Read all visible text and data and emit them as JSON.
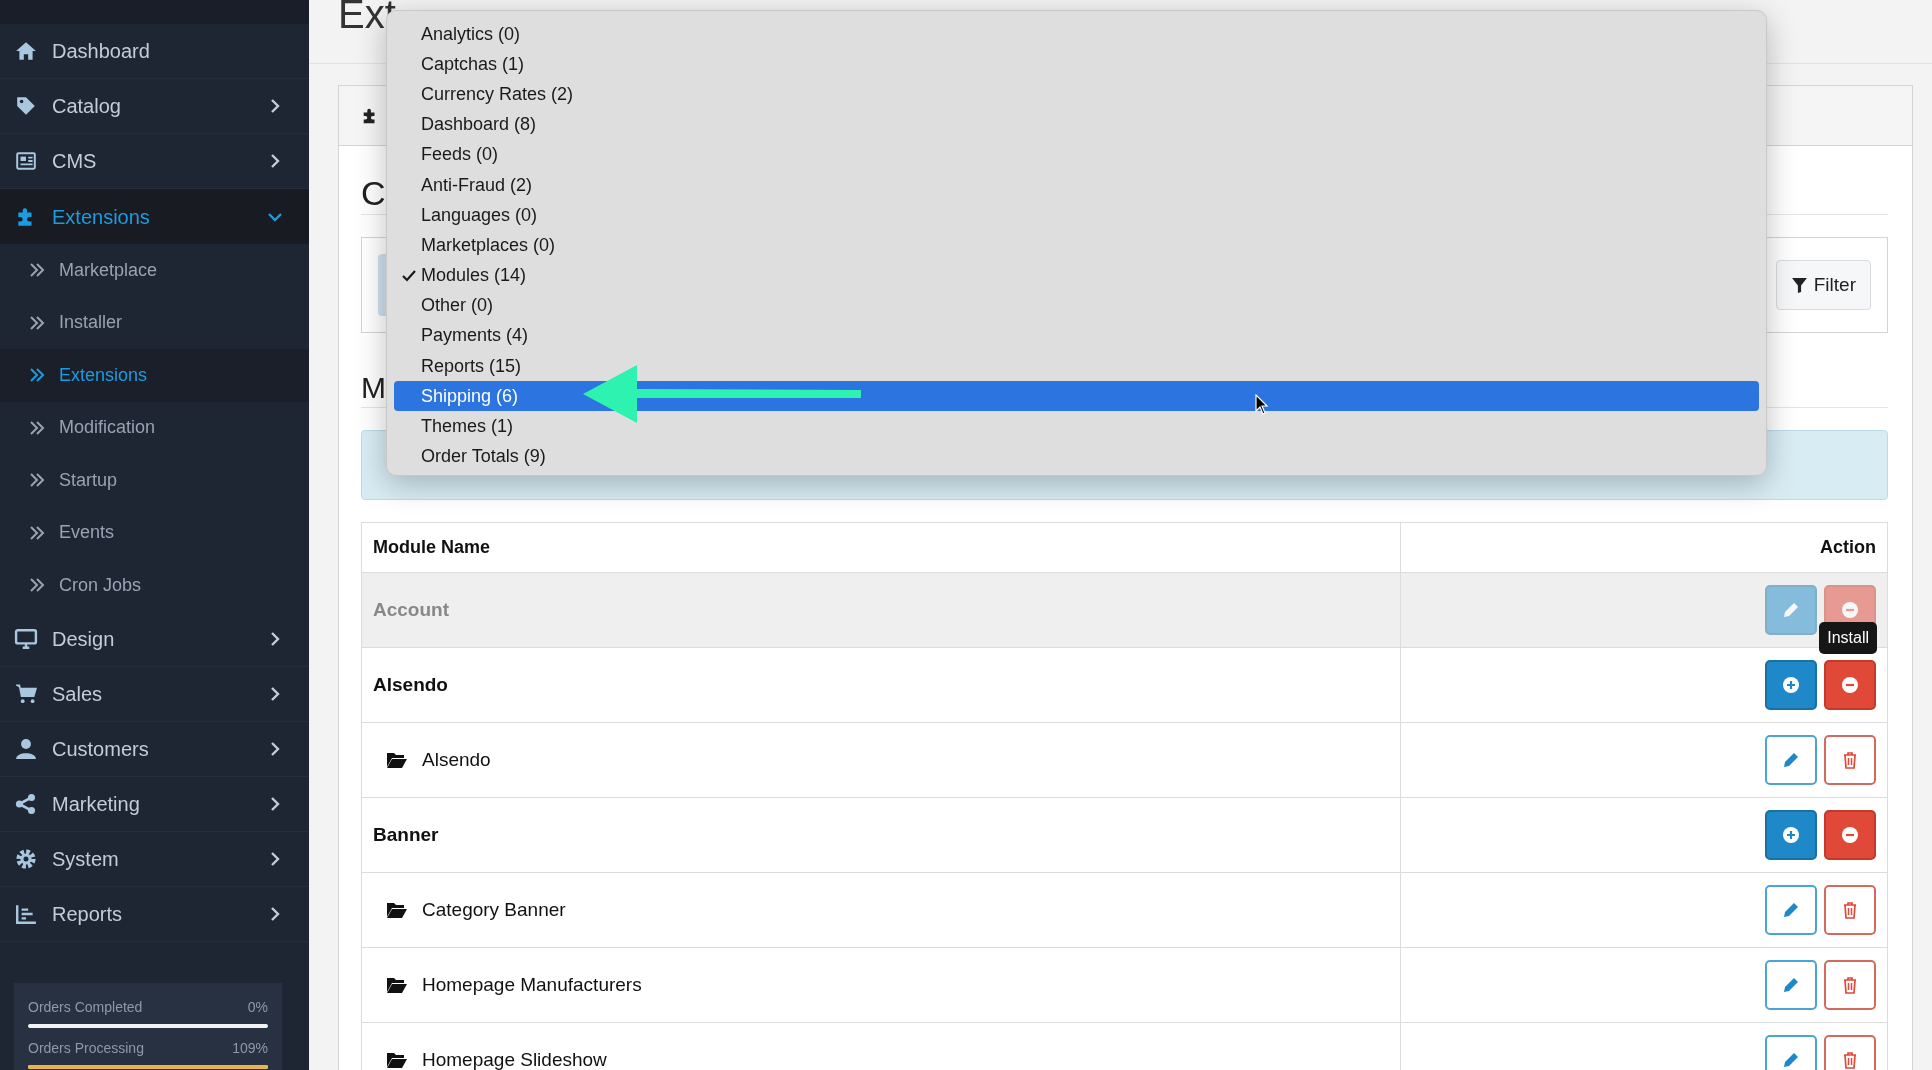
{
  "sidebar": {
    "items": [
      {
        "label": "Dashboard",
        "kind": "home",
        "expandable": false,
        "expanded": false
      },
      {
        "label": "Catalog",
        "kind": "tag",
        "expandable": true,
        "expanded": false
      },
      {
        "label": "CMS",
        "kind": "newspaper",
        "expandable": true,
        "expanded": false
      },
      {
        "label": "Extensions",
        "kind": "puzzle",
        "expandable": true,
        "expanded": true,
        "children": [
          {
            "label": "Marketplace",
            "selected": false
          },
          {
            "label": "Installer",
            "selected": false
          },
          {
            "label": "Extensions",
            "selected": true
          },
          {
            "label": "Modification",
            "selected": false
          },
          {
            "label": "Startup",
            "selected": false
          },
          {
            "label": "Events",
            "selected": false
          },
          {
            "label": "Cron Jobs",
            "selected": false
          }
        ]
      },
      {
        "label": "Design",
        "kind": "monitor",
        "expandable": true,
        "expanded": false
      },
      {
        "label": "Sales",
        "kind": "cart",
        "expandable": true,
        "expanded": false
      },
      {
        "label": "Customers",
        "kind": "user",
        "expandable": true,
        "expanded": false
      },
      {
        "label": "Marketing",
        "kind": "share",
        "expandable": true,
        "expanded": false
      },
      {
        "label": "System",
        "kind": "gear",
        "expandable": true,
        "expanded": false
      },
      {
        "label": "Reports",
        "kind": "chart",
        "expandable": true,
        "expanded": false
      }
    ],
    "stats": [
      {
        "label": "Orders Completed",
        "value": "0%",
        "level": 0
      },
      {
        "label": "Orders Processing",
        "value": "109%",
        "level": 1
      }
    ]
  },
  "page_title": "Ext",
  "panel": {
    "heading_1": "C",
    "filter_button": "Filter",
    "heading_2": "M"
  },
  "table": {
    "columns": [
      "Module Name",
      "Action"
    ],
    "rows": [
      {
        "kind": "group",
        "name": "Account",
        "disabled": true,
        "actions": [
          {
            "kind": "edit"
          },
          {
            "kind": "uninstall"
          }
        ]
      },
      {
        "kind": "group",
        "name": "Alsendo",
        "disabled": false,
        "actions": [
          {
            "kind": "install"
          },
          {
            "kind": "uninstall"
          }
        ],
        "tooltip": "Install"
      },
      {
        "kind": "module",
        "name": "Alsendo",
        "disabled": false,
        "actions": [
          {
            "kind": "edit"
          },
          {
            "kind": "delete"
          }
        ]
      },
      {
        "kind": "group",
        "name": "Banner",
        "disabled": false,
        "actions": [
          {
            "kind": "install"
          },
          {
            "kind": "uninstall"
          }
        ]
      },
      {
        "kind": "module",
        "name": "Category Banner",
        "disabled": false,
        "actions": [
          {
            "kind": "edit"
          },
          {
            "kind": "delete"
          }
        ]
      },
      {
        "kind": "module",
        "name": "Homepage Manufacturers",
        "disabled": false,
        "actions": [
          {
            "kind": "edit"
          },
          {
            "kind": "delete"
          }
        ]
      },
      {
        "kind": "module",
        "name": "Homepage Slideshow",
        "disabled": false,
        "actions": [
          {
            "kind": "edit"
          },
          {
            "kind": "delete"
          }
        ]
      }
    ]
  },
  "dropdown": {
    "items": [
      {
        "label": "Analytics (0)",
        "checked": false,
        "selected": false
      },
      {
        "label": "Captchas (1)",
        "checked": false,
        "selected": false
      },
      {
        "label": "Currency Rates (2)",
        "checked": false,
        "selected": false
      },
      {
        "label": "Dashboard (8)",
        "checked": false,
        "selected": false
      },
      {
        "label": "Feeds (0)",
        "checked": false,
        "selected": false
      },
      {
        "label": "Anti-Fraud (2)",
        "checked": false,
        "selected": false
      },
      {
        "label": "Languages (0)",
        "checked": false,
        "selected": false
      },
      {
        "label": "Marketplaces (0)",
        "checked": false,
        "selected": false
      },
      {
        "label": "Modules (14)",
        "checked": true,
        "selected": false
      },
      {
        "label": "Other (0)",
        "checked": false,
        "selected": false
      },
      {
        "label": "Payments (4)",
        "checked": false,
        "selected": false
      },
      {
        "label": "Reports (15)",
        "checked": false,
        "selected": false
      },
      {
        "label": "Shipping (6)",
        "checked": false,
        "selected": true
      },
      {
        "label": "Themes (1)",
        "checked": false,
        "selected": false
      },
      {
        "label": "Order Totals (9)",
        "checked": false,
        "selected": false
      }
    ]
  }
}
